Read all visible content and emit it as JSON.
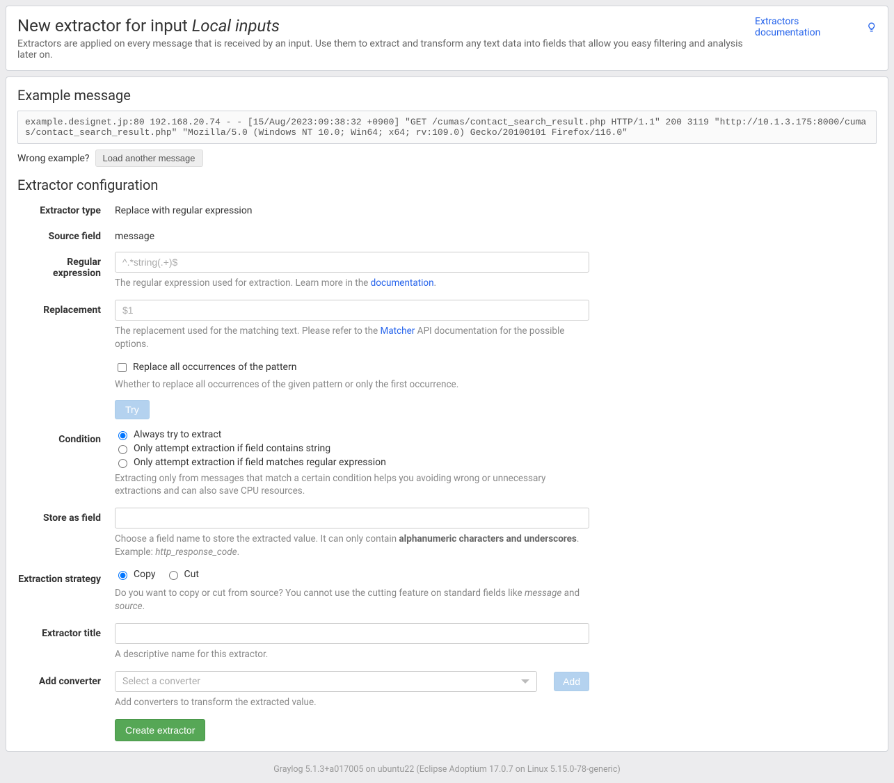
{
  "header": {
    "title_prefix": "New extractor for input ",
    "title_em": "Local inputs",
    "subtitle": "Extractors are applied on every message that is received by an input. Use them to extract and transform any text data into fields that allow you easy filtering and analysis later on.",
    "doc_link": "Extractors documentation"
  },
  "example": {
    "heading": "Example message",
    "content": "example.designet.jp:80 192.168.20.74 - - [15/Aug/2023:09:38:32 +0900] \"GET /cumas/contact_search_result.php HTTP/1.1\" 200 3119 \"http://10.1.3.175:8000/cumas/contact_search_result.php\" \"Mozilla/5.0 (Windows NT 10.0; Win64; x64; rv:109.0) Gecko/20100101 Firefox/116.0\"",
    "wrong_label": "Wrong example?",
    "load_button": "Load another message"
  },
  "config": {
    "heading": "Extractor configuration",
    "type_label": "Extractor type",
    "type_value": "Replace with regular expression",
    "source_label": "Source field",
    "source_value": "message",
    "regex_label": "Regular expression",
    "regex_placeholder": "^.*string(.+)$",
    "regex_help_pre": "The regular expression used for extraction. Learn more in the ",
    "regex_help_link": "documentation",
    "replacement_label": "Replacement",
    "replacement_placeholder": "$1",
    "replacement_help_pre": "The replacement used for the matching text. Please refer to the ",
    "replacement_help_link": "Matcher",
    "replacement_help_post": " API documentation for the possible options.",
    "replace_all_label": "Replace all occurrences of the pattern",
    "replace_all_help": "Whether to replace all occurrences of the given pattern or only the first occurrence.",
    "try_button": "Try",
    "condition_label": "Condition",
    "condition_opt1": "Always try to extract",
    "condition_opt2": "Only attempt extraction if field contains string",
    "condition_opt3": "Only attempt extraction if field matches regular expression",
    "condition_help": "Extracting only from messages that match a certain condition helps you avoiding wrong or unnecessary extractions and can also save CPU resources.",
    "store_label": "Store as field",
    "store_help_pre": "Choose a field name to store the extracted value. It can only contain ",
    "store_help_strong": "alphanumeric characters and underscores",
    "store_help_post": ". Example: ",
    "store_help_em": "http_response_code",
    "strategy_label": "Extraction strategy",
    "strategy_copy": "Copy",
    "strategy_cut": "Cut",
    "strategy_help_pre": "Do you want to copy or cut from source? You cannot use the cutting feature on standard fields like ",
    "strategy_help_em1": "message",
    "strategy_help_mid": " and ",
    "strategy_help_em2": "source",
    "title_label": "Extractor title",
    "title_help": "A descriptive name for this extractor.",
    "converter_label": "Add converter",
    "converter_placeholder": "Select a converter",
    "converter_add": "Add",
    "converter_help": "Add converters to transform the extracted value.",
    "create_button": "Create extractor"
  },
  "footer": "Graylog 5.1.3+a017005 on ubuntu22 (Eclipse Adoptium 17.0.7 on Linux 5.15.0-78-generic)"
}
